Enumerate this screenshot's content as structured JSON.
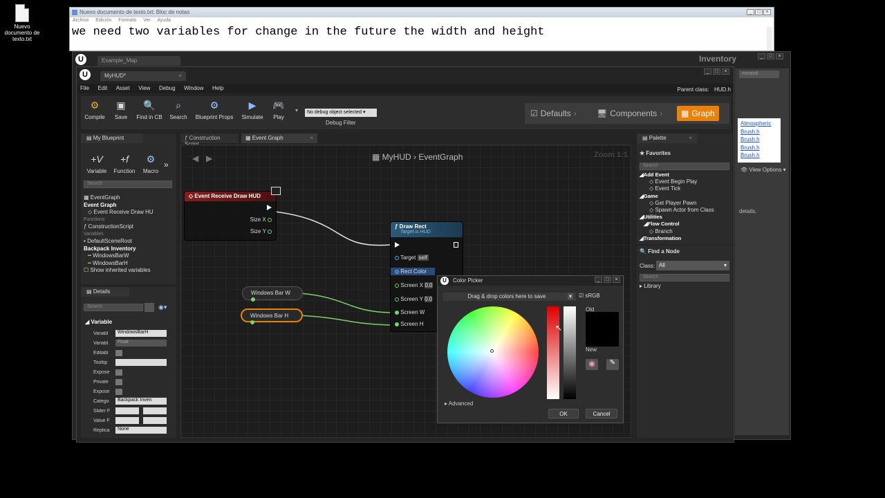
{
  "desktop": {
    "icon_label": "Nuevo documento de texto.txt"
  },
  "notepad": {
    "title": "Nuevo documento de texto.txt: Bloc de notas",
    "menu": [
      "Archivo",
      "Edición",
      "Formato",
      "Ver",
      "Ayuda"
    ],
    "content": "we need two variables for change in the future the width and height"
  },
  "back_editor": {
    "tab": "Example_Map",
    "title": "Inventory",
    "command_placeholder": "mmand",
    "asset_list": [
      "Atmospheric",
      "Brush.h",
      "Brush.h",
      "Brush.h",
      "Brush.h"
    ],
    "view_options": "View Options",
    "details_text": "details."
  },
  "editor": {
    "tab": "MyHUD*",
    "parent_class_label": "Parent class:",
    "parent_class": "HUD.h",
    "menu": [
      "File",
      "Edit",
      "Asset",
      "View",
      "Debug",
      "Window",
      "Help"
    ],
    "toolbar": {
      "compile": "Compile",
      "save": "Save",
      "find_in_cb": "Find in CB",
      "search": "Search",
      "blueprint_props": "Blueprint Props",
      "simulate": "Simulate",
      "play": "Play",
      "debug_select": "No debug object selected",
      "debug_filter": "Debug Filter"
    },
    "modes": {
      "defaults": "Defaults",
      "components": "Components",
      "graph": "Graph"
    }
  },
  "my_blueprint": {
    "title": "My Blueprint",
    "add_variable": "Variable",
    "add_function": "Function",
    "add_macro": "Macro",
    "search_placeholder": "Search",
    "tree": {
      "eventgraph": "EventGraph",
      "event_graph_cat": "Event Graph",
      "event_receive": "Event Receive Draw HU",
      "functions": "Functions",
      "construction": "ConstructionScript",
      "variables": "Variables",
      "default_scene_root": "DefaultSceneRoot",
      "backpack_cat": "Backpack Inventory",
      "var1": "WindowsBarW",
      "var2": "WindowsBarH",
      "show_inherited": "Show inherited variables"
    }
  },
  "details": {
    "title": "Details",
    "search_placeholder": "Search",
    "section": "Variable",
    "rows": [
      {
        "label": "Variabl",
        "value": "WindowsBarH"
      },
      {
        "label": "Variabl",
        "value": "Float"
      },
      {
        "label": "Editabl",
        "value": ""
      },
      {
        "label": "Tooltip",
        "value": ""
      },
      {
        "label": "Expose",
        "value": ""
      },
      {
        "label": "Private",
        "value": ""
      },
      {
        "label": "Expose",
        "value": ""
      },
      {
        "label": "Catego",
        "value": "Backpack Inven"
      },
      {
        "label": "Slider F",
        "value": ""
      },
      {
        "label": "Value F",
        "value": ""
      },
      {
        "label": "Replica",
        "value": "None"
      }
    ]
  },
  "graph": {
    "tabs": [
      "Construction Script",
      "Event Graph"
    ],
    "breadcrumb_root": "MyHUD",
    "breadcrumb_leaf": "EventGraph",
    "zoom": "Zoom 1:1",
    "event_node": {
      "title": "Event Receive Draw HUD",
      "pin_x": "Size X",
      "pin_y": "Size Y"
    },
    "draw_rect": {
      "title": "Draw Rect",
      "subtitle": "Target is HUD",
      "target": "Target",
      "self": "self",
      "rect_color": "Rect Color",
      "screen_x": "Screen X",
      "screen_y": "Screen Y",
      "screen_w": "Screen W",
      "screen_h": "Screen H",
      "zero": "0.0"
    },
    "get_w": "Windows Bar W",
    "get_h": "Windows Bar H"
  },
  "palette": {
    "title": "Palette",
    "favorites": "Favorites",
    "search_placeholder": "Search",
    "items": [
      {
        "text": "Add Event",
        "kind": "cat"
      },
      {
        "text": "Event Begin Play",
        "kind": "item"
      },
      {
        "text": "Event Tick",
        "kind": "item"
      },
      {
        "text": "Game",
        "kind": "cat"
      },
      {
        "text": "Get Player Pawn",
        "kind": "item"
      },
      {
        "text": "Spawn Actor from Class",
        "kind": "item"
      },
      {
        "text": "Utilities",
        "kind": "cat"
      },
      {
        "text": "Flow Control",
        "kind": "cat"
      },
      {
        "text": "Branch",
        "kind": "item"
      },
      {
        "text": "Transformation",
        "kind": "cat"
      }
    ],
    "find_node": "Find a Node",
    "class_label": "Class:",
    "class_value": "All",
    "library": "Library"
  },
  "color_picker": {
    "title": "Color Picker",
    "drag_text": "Drag & drop colors here to save",
    "srgb": "sRGB",
    "old": "Old",
    "new": "New",
    "advanced": "Advanced",
    "ok": "OK",
    "cancel": "Cancel"
  },
  "colors": {
    "accent": "#e8820c",
    "event_header": "#8a1c1c",
    "function_header": "#2a5a7a"
  }
}
